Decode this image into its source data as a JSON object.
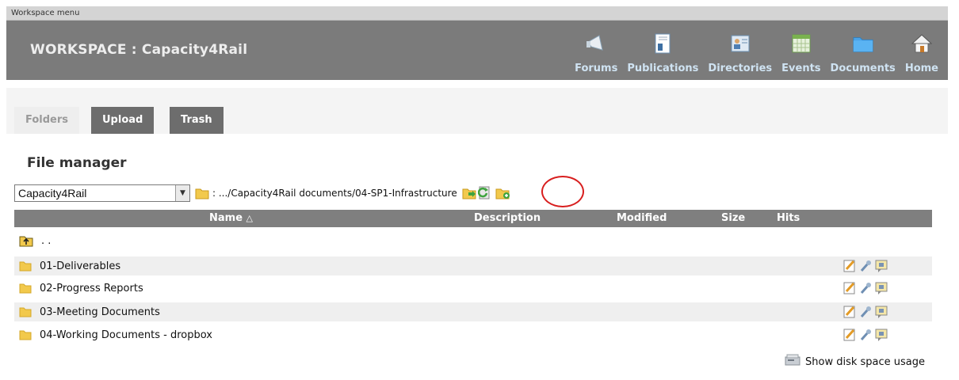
{
  "top_label": "Workspace menu",
  "workspace": {
    "title": "WORKSPACE : Capacity4Rail"
  },
  "nav": [
    {
      "label": "Forums",
      "icon": "megaphone-icon"
    },
    {
      "label": "Publications",
      "icon": "publications-icon"
    },
    {
      "label": "Directories",
      "icon": "directories-icon"
    },
    {
      "label": "Events",
      "icon": "calendar-icon"
    },
    {
      "label": "Documents",
      "icon": "folder-icon"
    },
    {
      "label": "Home",
      "icon": "home-icon"
    }
  ],
  "tabs": {
    "folders": "Folders",
    "upload": "Upload",
    "trash": "Trash"
  },
  "file_manager": {
    "title": "File manager",
    "selected_workspace": "Capacity4Rail",
    "path": ": .../Capacity4Rail documents/04-SP1-Infrastructure",
    "columns": {
      "name": "Name",
      "sort_indicator": "△",
      "description": "Description",
      "modified": "Modified",
      "size": "Size",
      "hits": "Hits"
    },
    "parent_label": ". .",
    "folders": [
      {
        "name": "01-Deliverables"
      },
      {
        "name": "02-Progress Reports"
      },
      {
        "name": "03-Meeting Documents"
      },
      {
        "name": "04-Working Documents - dropbox"
      }
    ],
    "disk_usage_label": "Show disk space usage"
  },
  "colors": {
    "header_bg": "#7b7b7b",
    "tab_dark": "#6d6d6d",
    "grid_head": "#7f7f7f",
    "nav_text": "#cfe3f2",
    "folder": "#f2c94c",
    "highlight_circle": "#d81e1e"
  }
}
